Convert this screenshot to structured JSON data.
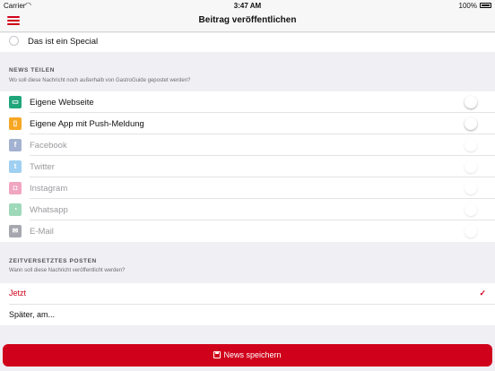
{
  "status_bar": {
    "carrier": "Carrier",
    "time": "3:47 AM",
    "battery": "100%"
  },
  "nav": {
    "title": "Beitrag veröffentlichen",
    "menu_icon": "hamburger-icon"
  },
  "special": {
    "label": "Das ist ein Special"
  },
  "share_section": {
    "header": "NEWS TEILEN",
    "subheader": "Wo soll diese Nachricht noch außerhalb von GastroGuide gepostet werden?",
    "items": [
      {
        "label": "Eigene Webseite",
        "icon": "monitor-icon",
        "color": "#1fa67a",
        "enabled": true
      },
      {
        "label": "Eigene App mit Push-Meldung",
        "icon": "app-icon",
        "color": "#f5a623",
        "enabled": true
      },
      {
        "label": "Facebook",
        "icon": "facebook-icon",
        "color": "#a4b2d2",
        "enabled": false
      },
      {
        "label": "Twitter",
        "icon": "twitter-icon",
        "color": "#9fd0f2",
        "enabled": false
      },
      {
        "label": "Instagram",
        "icon": "instagram-icon",
        "color": "#f0a6c0",
        "enabled": false
      },
      {
        "label": "Whatsapp",
        "icon": "whatsapp-icon",
        "color": "#9fd9b9",
        "enabled": false
      },
      {
        "label": "E-Mail",
        "icon": "mail-icon",
        "color": "#a7a7b0",
        "enabled": false
      }
    ]
  },
  "schedule_section": {
    "header": "ZEITVERSETZTES POSTEN",
    "subheader": "Wann soll diese Nachricht veröffentlicht werden?",
    "options": [
      {
        "label": "Jetzt",
        "selected": true
      },
      {
        "label": "Später, am...",
        "selected": false
      }
    ]
  },
  "save_button": {
    "label": "News speichern",
    "icon": "save-icon"
  },
  "colors": {
    "accent": "#d0021b",
    "background": "#efeff4"
  }
}
